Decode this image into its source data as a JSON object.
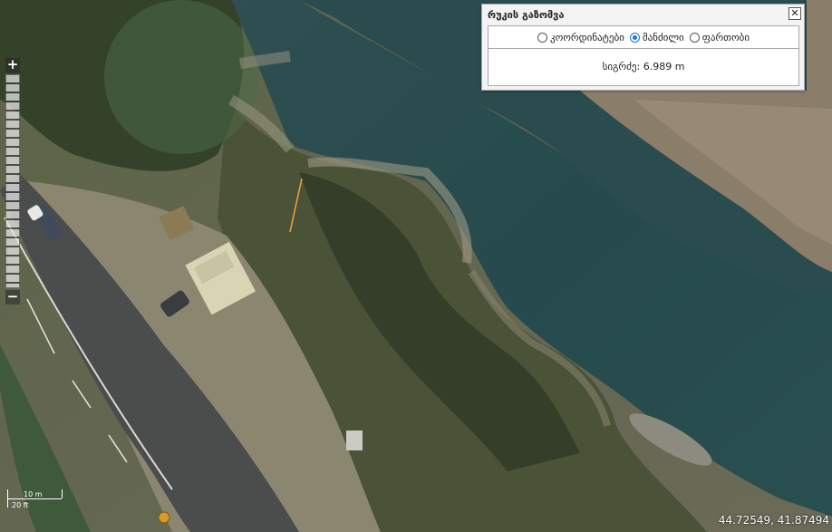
{
  "map": {
    "type": "satellite imagery",
    "measure_line_color": "#f2a33a"
  },
  "zoom": {
    "in_label": "+",
    "out_label": "−"
  },
  "panel": {
    "title": "რუკის გაზომვა",
    "close_label": "✕",
    "options": [
      {
        "label": "კოორდინატები",
        "selected": false
      },
      {
        "label": "მანძილი",
        "selected": true
      },
      {
        "label": "ფართობი",
        "selected": false
      }
    ],
    "result_label": "სიგრძე:",
    "result_value": "6.989 m"
  },
  "scale": {
    "metric": "10 m",
    "imperial": "20 ft"
  },
  "coordinates": "44.72549, 41.87494"
}
